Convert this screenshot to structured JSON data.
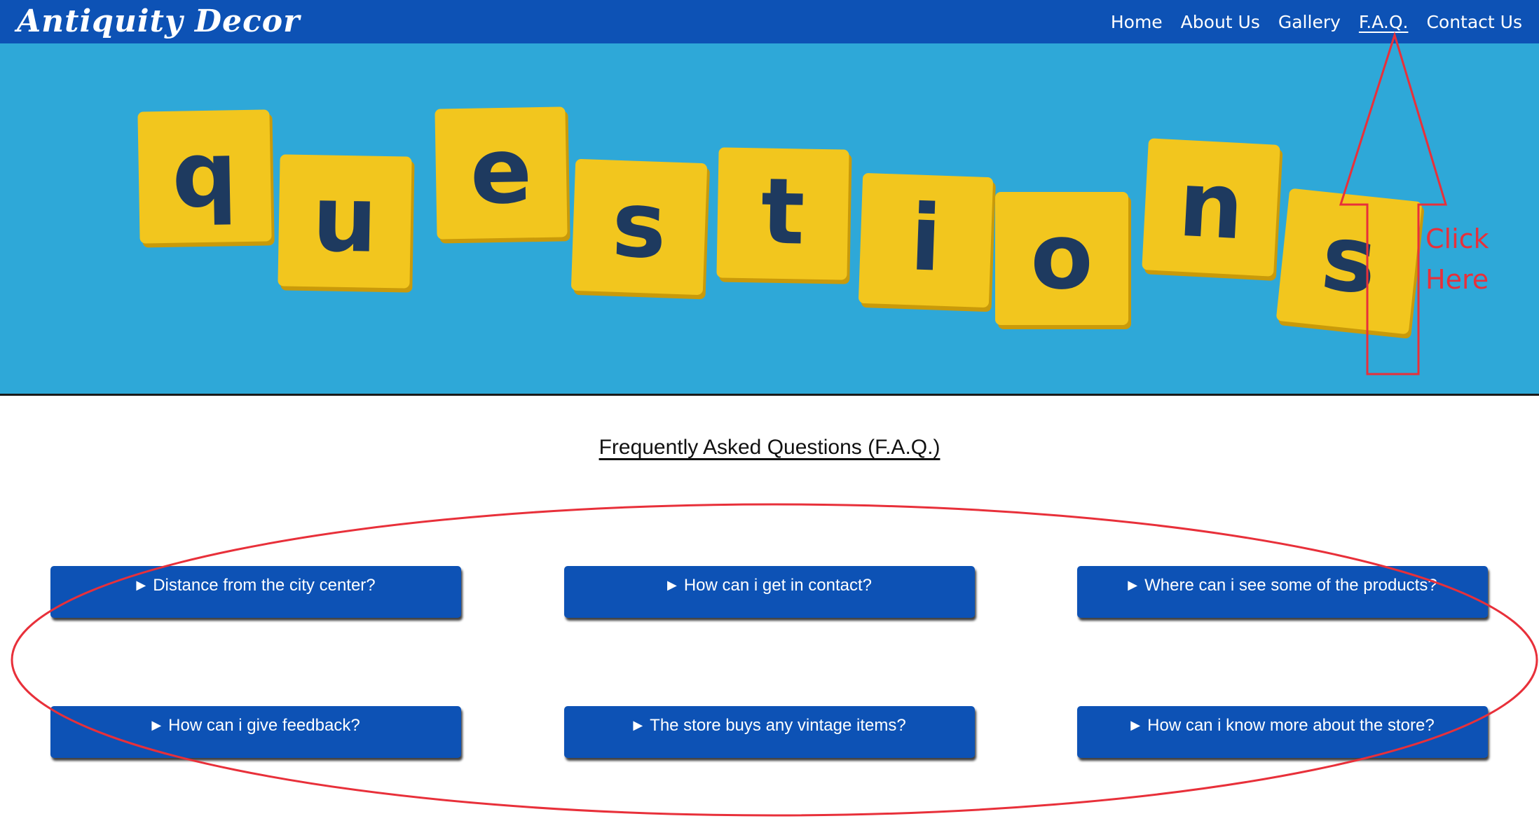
{
  "brand": {
    "name": "Antiquity Decor"
  },
  "nav": {
    "items": [
      {
        "label": "Home"
      },
      {
        "label": "About Us"
      },
      {
        "label": "Gallery"
      },
      {
        "label": "F.A.Q."
      },
      {
        "label": "Contact Us"
      }
    ],
    "active": "F.A.Q."
  },
  "hero": {
    "tile_letters": [
      "q",
      "u",
      "e",
      "s",
      "t",
      "i",
      "o",
      "n",
      "s"
    ],
    "tile_color": "#f2c61e",
    "letter_color": "#1e3a5f",
    "background_color": "#2ea8d8"
  },
  "faq": {
    "title": "Frequently Asked Questions (F.A.Q.)",
    "questions": [
      "Distance from the city center?",
      "How can i get in contact?",
      "Where can i see some of the products?",
      "How can i give feedback?",
      "The store buys any vintage items?",
      "How can i know more about the store?"
    ]
  },
  "annotation": {
    "label_line1": "Click",
    "label_line2": "Here",
    "color": "#e8303a"
  },
  "colors": {
    "nav_bg": "#0d52b5",
    "button_bg": "#0d52b5",
    "annotation": "#e8303a"
  }
}
